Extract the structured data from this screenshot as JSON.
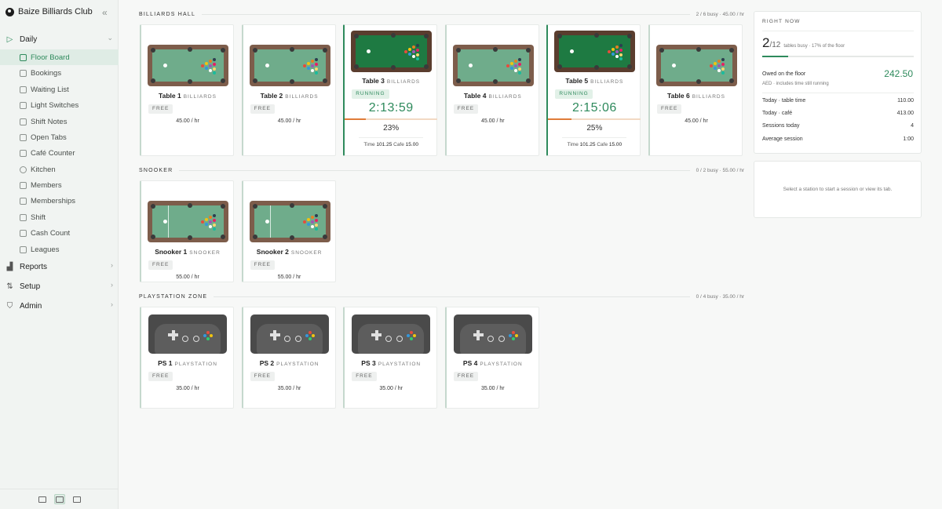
{
  "app": {
    "title": "Baize Billiards Club"
  },
  "sidebar": {
    "groups": [
      {
        "label": "Daily",
        "items": [
          {
            "label": "Floor Board",
            "active": true
          },
          {
            "label": "Bookings"
          },
          {
            "label": "Waiting List"
          },
          {
            "label": "Light Switches"
          },
          {
            "label": "Shift Notes"
          },
          {
            "label": "Open Tabs"
          },
          {
            "label": "Café Counter"
          },
          {
            "label": "Kitchen"
          },
          {
            "label": "Members"
          },
          {
            "label": "Memberships"
          },
          {
            "label": "Shift"
          },
          {
            "label": "Cash Count"
          },
          {
            "label": "Leagues"
          }
        ]
      },
      {
        "label": "Reports"
      },
      {
        "label": "Setup"
      },
      {
        "label": "Admin"
      }
    ]
  },
  "sections": [
    {
      "title": "BILLIARDS HALL",
      "meta": "2 / 6 busy · 45.00 / hr",
      "stations": [
        {
          "name": "Table 1",
          "type": "BILLIARDS",
          "status": "FREE",
          "rate": "45.00 / hr"
        },
        {
          "name": "Table 2",
          "type": "BILLIARDS",
          "status": "FREE",
          "rate": "45.00 / hr"
        },
        {
          "name": "Table 3",
          "type": "BILLIARDS",
          "status": "RUNNING",
          "timer": "2:13:59",
          "progress": 0.23,
          "percent": "23%",
          "time_label": "Time",
          "time_value": "101.25",
          "cafe_label": "Cafe",
          "cafe_value": "15.00"
        },
        {
          "name": "Table 4",
          "type": "BILLIARDS",
          "status": "FREE",
          "rate": "45.00 / hr"
        },
        {
          "name": "Table 5",
          "type": "BILLIARDS",
          "status": "RUNNING",
          "timer": "2:15:06",
          "progress": 0.25,
          "percent": "25%",
          "time_label": "Time",
          "time_value": "101.25",
          "cafe_label": "Cafe",
          "cafe_value": "15.00"
        },
        {
          "name": "Table 6",
          "type": "BILLIARDS",
          "status": "FREE",
          "rate": "45.00 / hr"
        }
      ]
    },
    {
      "title": "SNOOKER",
      "meta": "0 / 2 busy · 55.00 / hr",
      "stations": [
        {
          "name": "Snooker 1",
          "type": "SNOOKER",
          "status": "FREE",
          "rate": "55.00 / hr"
        },
        {
          "name": "Snooker 2",
          "type": "SNOOKER",
          "status": "FREE",
          "rate": "55.00 / hr"
        }
      ]
    },
    {
      "title": "PLAYSTATION ZONE",
      "meta": "0 / 4 busy · 35.00 / hr",
      "stations": [
        {
          "name": "PS 1",
          "type": "PLAYSTATION",
          "status": "FREE",
          "rate": "35.00 / hr"
        },
        {
          "name": "PS 2",
          "type": "PLAYSTATION",
          "status": "FREE",
          "rate": "35.00 / hr"
        },
        {
          "name": "PS 3",
          "type": "PLAYSTATION",
          "status": "FREE",
          "rate": "35.00 / hr"
        },
        {
          "name": "PS 4",
          "type": "PLAYSTATION",
          "status": "FREE",
          "rate": "35.00 / hr"
        }
      ]
    }
  ],
  "panel": {
    "title": "RIGHT NOW",
    "busy": "2",
    "total": "/12",
    "busy_sub": "tables busy · 17% of the floor",
    "busy_fraction": 0.17,
    "owed_label": "Owed on the floor",
    "owed_sub": "AED · includes time still running",
    "owed_value": "242.50",
    "rows": [
      {
        "label": "Today · table time",
        "value": "110.00"
      },
      {
        "label": "Today · café",
        "value": "413.00"
      },
      {
        "label": "Sessions today",
        "value": "4"
      },
      {
        "label": "Average session",
        "value": "1:00"
      }
    ]
  },
  "hint": "Select a station to start a session or view its tab.",
  "colors": {
    "accent": "#2e8a5c",
    "progress": "#e07b39",
    "felt": "#6fac8b",
    "felt_running": "#1e7a42"
  }
}
